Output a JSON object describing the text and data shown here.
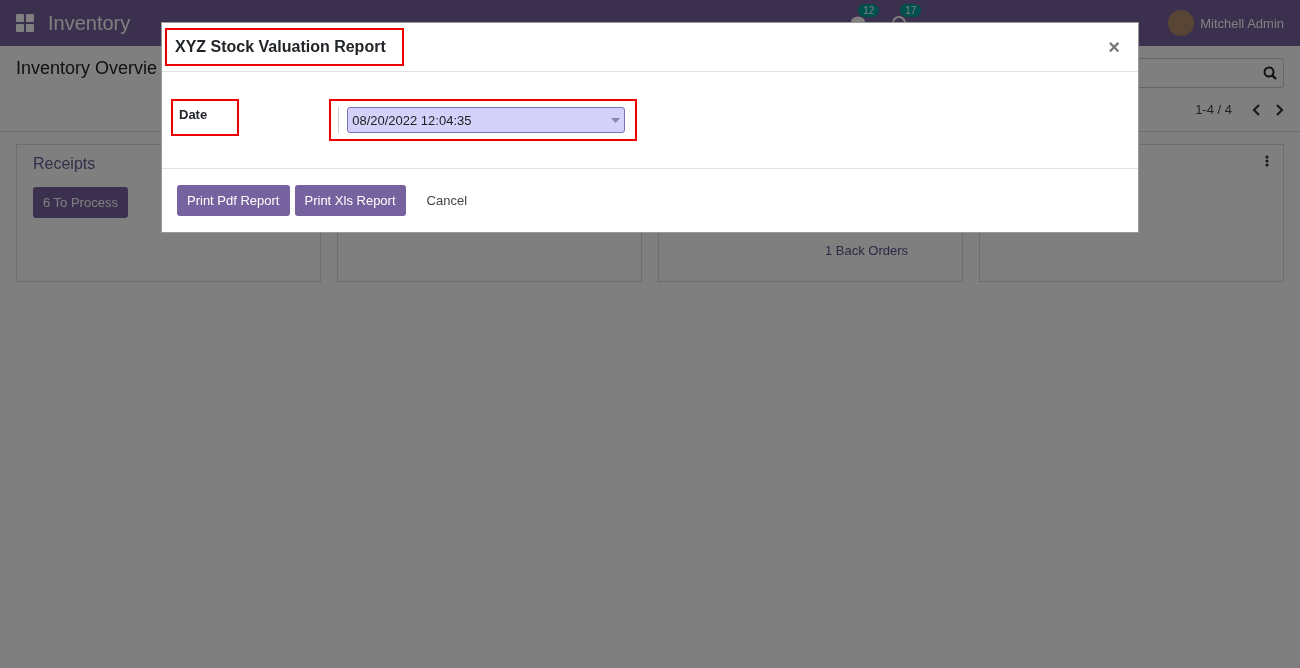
{
  "navbar": {
    "app_name": "Inventory",
    "messages_count": "12",
    "activities_count": "17",
    "user": "Mitchell Admin"
  },
  "control_panel": {
    "title": "Inventory Overvie",
    "pager": "1-4 / 4"
  },
  "cards": [
    {
      "kind": "card",
      "title": "Receipts",
      "button": "6 To Process"
    },
    {
      "kind": "card"
    },
    {
      "kind": "card",
      "link": "1 Back Orders"
    },
    {
      "kind": "card",
      "menu": true
    }
  ],
  "dialog": {
    "title": "XYZ Stock Valuation Report",
    "close": "×",
    "field_label": "Date",
    "field_value": "08/20/2022 12:04:35",
    "buttons": [
      {
        "label": "Print Pdf Report",
        "kind": "primary"
      },
      {
        "label": "Print Xls Report",
        "kind": "primary"
      },
      {
        "label": "Cancel",
        "kind": "link"
      }
    ]
  }
}
